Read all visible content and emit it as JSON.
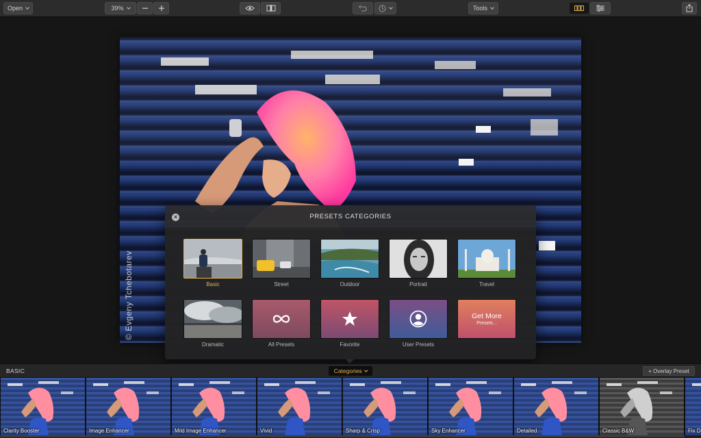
{
  "toolbar": {
    "open_label": "Open",
    "zoom_value": "39%",
    "tools_label": "Tools",
    "icons": [
      "eye-icon",
      "compare-icon",
      "undo-icon",
      "history-icon",
      "presets-view-icon",
      "adjustments-icon",
      "share-icon"
    ]
  },
  "photo": {
    "watermark": "© Evgeny Tchebotarev"
  },
  "modal": {
    "title": "PRESETS CATEGORIES",
    "categories": [
      {
        "label": "Basic",
        "selected": true
      },
      {
        "label": "Street"
      },
      {
        "label": "Outdoor"
      },
      {
        "label": "Portrait"
      },
      {
        "label": "Travel"
      },
      {
        "label": "Dramatic"
      },
      {
        "label": "All Presets"
      },
      {
        "label": "Favorite"
      },
      {
        "label": "User Presets"
      },
      {
        "label": "Get More",
        "sublabel": "Presets..."
      }
    ]
  },
  "bottombar": {
    "section_label": "BASIC",
    "categories_label": "Categories",
    "overlay_label": "+ Overlay Preset"
  },
  "presets": [
    {
      "name": "Clarity Booster"
    },
    {
      "name": "Image Enhancer"
    },
    {
      "name": "Mild Image Enhancer"
    },
    {
      "name": "Vivid"
    },
    {
      "name": "Sharp & Crisp"
    },
    {
      "name": "Sky Enhancer"
    },
    {
      "name": "Detailed"
    },
    {
      "name": "Classic B&W"
    },
    {
      "name": "Fix D"
    }
  ],
  "colors": {
    "accent": "#e2b350",
    "toolbar_bg": "#2c2c2c",
    "modal_bg": "#2c2c2e"
  }
}
